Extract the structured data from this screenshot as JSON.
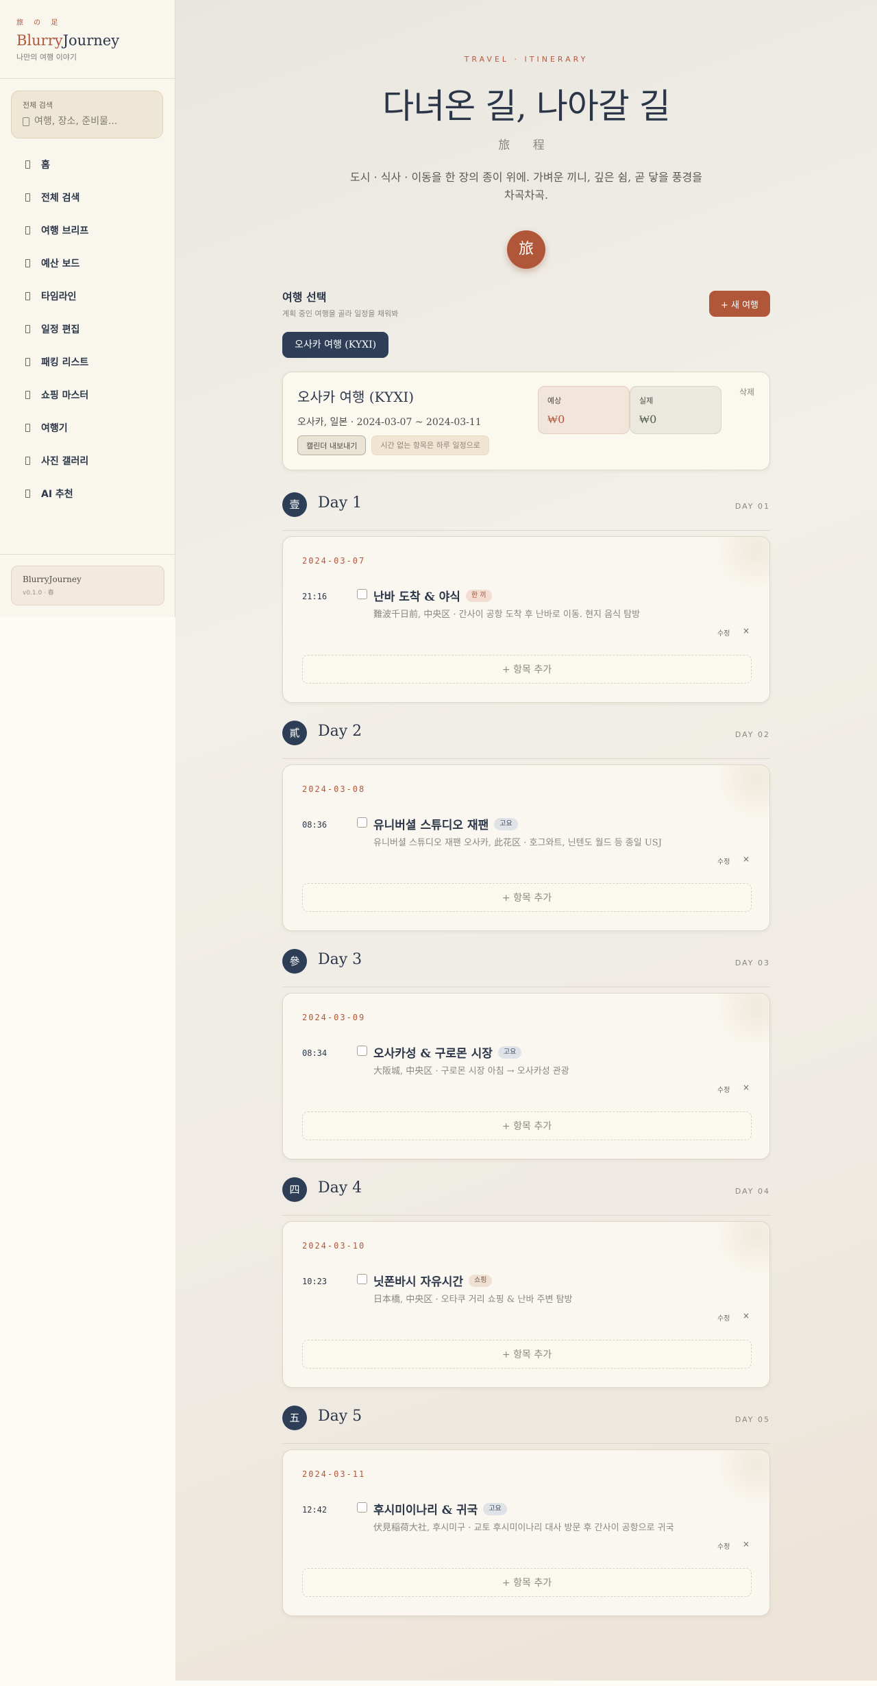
{
  "brand": {
    "kanji": "旅 の 足",
    "name_part1": "Blurry",
    "name_part2": "Journey",
    "subtitle": "나만의 여행 이야기"
  },
  "search": {
    "label": "전체 검색",
    "placeholder": "여행, 장소, 준비물..."
  },
  "nav": [
    {
      "label": "홈",
      "icon": "home-icon"
    },
    {
      "label": "전체 검색",
      "icon": "search-icon"
    },
    {
      "label": "여행 브리프",
      "icon": "brief-icon"
    },
    {
      "label": "예산 보드",
      "icon": "budget-icon"
    },
    {
      "label": "타임라인",
      "icon": "timeline-icon"
    },
    {
      "label": "일정 편집",
      "icon": "edit-icon"
    },
    {
      "label": "패킹 리스트",
      "icon": "packing-icon"
    },
    {
      "label": "쇼핑 마스터",
      "icon": "shopping-icon"
    },
    {
      "label": "여행기",
      "icon": "journal-icon"
    },
    {
      "label": "사진 갤러리",
      "icon": "gallery-icon"
    },
    {
      "label": "AI 추천",
      "icon": "ai-icon"
    }
  ],
  "footer": {
    "name": "BlurryJourney",
    "version": "v0.1.0 · 春"
  },
  "hero": {
    "eyebrow": "TRAVEL · ITINERARY",
    "title": "다녀온 길, 나아갈 길",
    "kanji": "旅 程",
    "description": "도시 · 식사 · 이동을 한 장의 종이 위에. 가벼운 끼니, 깊은 쉼, 곧 닿을 풍경을 차곡차곡.",
    "badge": "旅"
  },
  "trip_selector": {
    "title": "여행 선택",
    "subtitle": "계획 중인 여행을 골라 일정을 채워봐",
    "new_trip_label": "+ 새 여행",
    "selected_chip": "오사카 여행 (KYXI)"
  },
  "trip": {
    "name": "오사카 여행 (KYXI)",
    "meta": "오사카, 일본 · 2024-03-07 ~ 2024-03-11",
    "calendar_export": "캘린더 내보내기",
    "untimed_note": "시간 없는 항목은 하루 일정으로",
    "expected_label": "예상",
    "expected_value": "₩0",
    "actual_label": "실제",
    "actual_value": "₩0",
    "delete_label": "삭제"
  },
  "labels": {
    "edit": "수정",
    "delete": "×",
    "add_item": "+ 항목 추가"
  },
  "colors": {
    "accent": "#b0573a",
    "navy": "#2e3e57",
    "paper": "#faf7f0"
  },
  "days": [
    {
      "num": "壹",
      "title": "Day 1",
      "code": "DAY 01",
      "date": "2024-03-07",
      "time": "21:16",
      "item": "난바 도착 & 야식",
      "tag": "한 끼",
      "tag_type": "food",
      "desc": "難波千日前, 中央区 · 간사이 공항 도착 후 난바로 이동. 현지 음식 탐방"
    },
    {
      "num": "貳",
      "title": "Day 2",
      "code": "DAY 02",
      "date": "2024-03-08",
      "time": "08:36",
      "item": "유니버셜 스튜디오 재팬",
      "tag": "고요",
      "tag_type": "sight",
      "desc": "유니버셜 스튜디오 재팬 오사카, 此花区 · 호그와트, 닌텐도 월드 등 종일 USJ"
    },
    {
      "num": "參",
      "title": "Day 3",
      "code": "DAY 03",
      "date": "2024-03-09",
      "time": "08:34",
      "item": "오사카성 & 구로몬 시장",
      "tag": "고요",
      "tag_type": "sight",
      "desc": "大阪城, 中央区 · 구로몬 시장 아침 → 오사카성 관광"
    },
    {
      "num": "四",
      "title": "Day 4",
      "code": "DAY 04",
      "date": "2024-03-10",
      "time": "10:23",
      "item": "닛폰바시 자유시간",
      "tag": "쇼핑",
      "tag_type": "shop",
      "desc": "日本橋, 中央区 · 오타쿠 거리 쇼핑 & 난바 주변 탐방"
    },
    {
      "num": "五",
      "title": "Day 5",
      "code": "DAY 05",
      "date": "2024-03-11",
      "time": "12:42",
      "item": "후시미이나리 & 귀국",
      "tag": "고요",
      "tag_type": "sight",
      "desc": "伏見稲荷大社, 후시미구 · 교토 후시미이나리 대사 방문 후 간사이 공항으로 귀국"
    }
  ]
}
